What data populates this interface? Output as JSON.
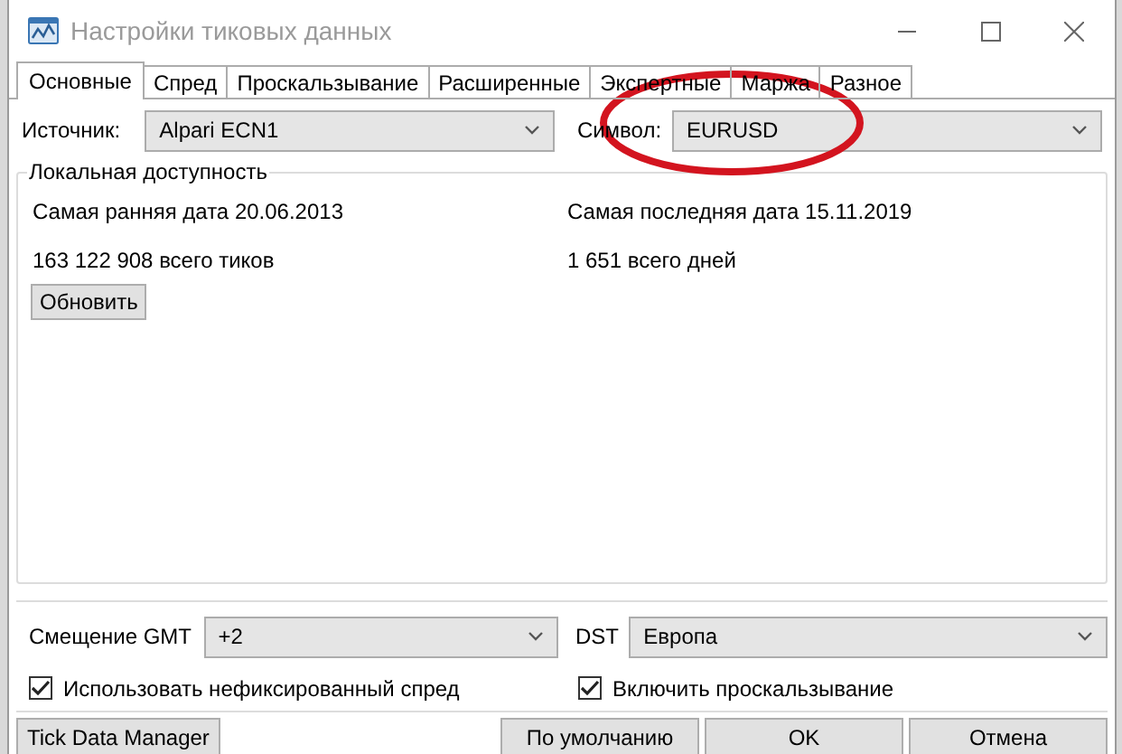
{
  "window": {
    "title": "Настройки тиковых данных"
  },
  "tabs": [
    {
      "label": "Основные",
      "selected": true
    },
    {
      "label": "Спред",
      "selected": false
    },
    {
      "label": "Проскальзывание",
      "selected": false
    },
    {
      "label": "Расширенные",
      "selected": false
    },
    {
      "label": "Экспертные",
      "selected": false
    },
    {
      "label": "Маржа",
      "selected": false
    },
    {
      "label": "Разное",
      "selected": false
    }
  ],
  "source": {
    "label": "Источник:",
    "value": "Alpari ECN1"
  },
  "symbol": {
    "label": "Символ:",
    "value": "EURUSD"
  },
  "local_availability": {
    "title": "Локальная доступность",
    "earliest": "Самая ранняя дата 20.06.2013",
    "latest": "Самая последняя дата 15.11.2019",
    "ticks": "163 122 908 всего тиков",
    "days": "1 651 всего дней",
    "refresh_button": "Обновить"
  },
  "gmt_offset": {
    "label": "Смещение GMT",
    "value": "+2"
  },
  "dst": {
    "label": "DST",
    "value": "Европа"
  },
  "checkboxes": [
    {
      "label": "Использовать нефиксированный спред",
      "checked": true
    },
    {
      "label": "Включить проскальзывание",
      "checked": true
    }
  ],
  "buttons": [
    {
      "label": "Tick Data Manager",
      "kind": "left"
    },
    {
      "label": "По умолчанию",
      "kind": "right"
    },
    {
      "label": "OK",
      "kind": "right"
    },
    {
      "label": "Отмена",
      "kind": "right"
    }
  ],
  "annotations": [
    {
      "kind": "ellipse"
    }
  ]
}
